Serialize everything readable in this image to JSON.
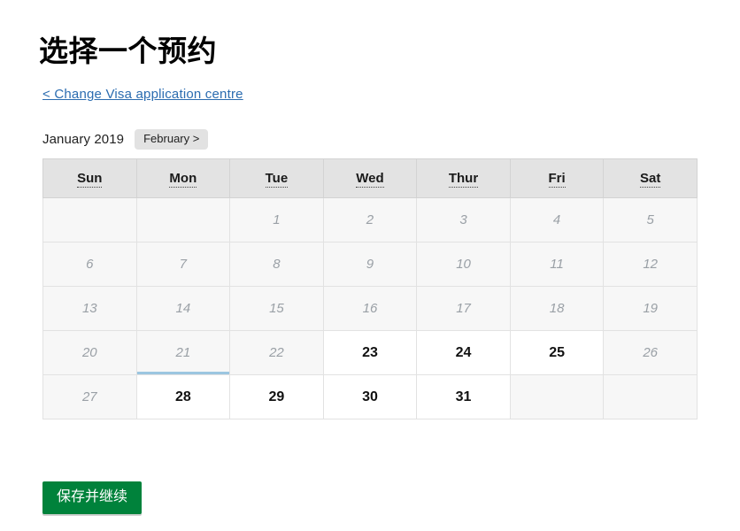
{
  "page": {
    "title": "选择一个预约",
    "back_link": "< Change Visa application centre",
    "submit_label": "保存并继续"
  },
  "month_nav": {
    "current_month": "January 2019",
    "next_month_label": "February >"
  },
  "calendar": {
    "weekday_headers": [
      "Sun",
      "Mon",
      "Tue",
      "Wed",
      "Thur",
      "Fri",
      "Sat"
    ],
    "weeks": [
      [
        {
          "day": "",
          "state": "empty"
        },
        {
          "day": "",
          "state": "empty"
        },
        {
          "day": "1",
          "state": "disabled"
        },
        {
          "day": "2",
          "state": "disabled"
        },
        {
          "day": "3",
          "state": "disabled"
        },
        {
          "day": "4",
          "state": "disabled"
        },
        {
          "day": "5",
          "state": "disabled"
        }
      ],
      [
        {
          "day": "6",
          "state": "disabled"
        },
        {
          "day": "7",
          "state": "disabled"
        },
        {
          "day": "8",
          "state": "disabled"
        },
        {
          "day": "9",
          "state": "disabled"
        },
        {
          "day": "10",
          "state": "disabled"
        },
        {
          "day": "11",
          "state": "disabled"
        },
        {
          "day": "12",
          "state": "disabled"
        }
      ],
      [
        {
          "day": "13",
          "state": "disabled"
        },
        {
          "day": "14",
          "state": "disabled"
        },
        {
          "day": "15",
          "state": "disabled"
        },
        {
          "day": "16",
          "state": "disabled"
        },
        {
          "day": "17",
          "state": "disabled"
        },
        {
          "day": "18",
          "state": "disabled"
        },
        {
          "day": "19",
          "state": "disabled"
        }
      ],
      [
        {
          "day": "20",
          "state": "disabled"
        },
        {
          "day": "21",
          "state": "disabled",
          "focused": true
        },
        {
          "day": "22",
          "state": "disabled"
        },
        {
          "day": "23",
          "state": "available"
        },
        {
          "day": "24",
          "state": "available"
        },
        {
          "day": "25",
          "state": "available"
        },
        {
          "day": "26",
          "state": "disabled"
        }
      ],
      [
        {
          "day": "27",
          "state": "disabled"
        },
        {
          "day": "28",
          "state": "available"
        },
        {
          "day": "29",
          "state": "available"
        },
        {
          "day": "30",
          "state": "available"
        },
        {
          "day": "31",
          "state": "available"
        },
        {
          "day": "",
          "state": "empty"
        },
        {
          "day": "",
          "state": "empty"
        }
      ]
    ]
  },
  "colors": {
    "link": "#2b6cb0",
    "submit_green": "#00823b",
    "header_gray": "#e3e3e3",
    "focus_blue": "#9cc6e0"
  }
}
